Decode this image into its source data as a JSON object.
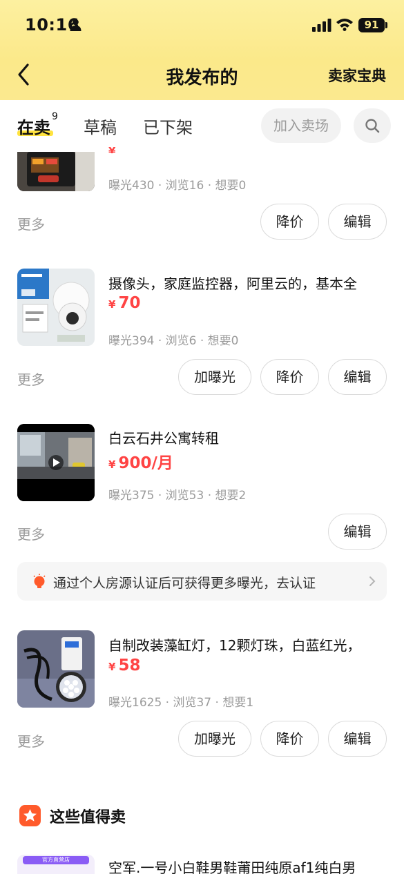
{
  "status_bar": {
    "time": "10:16",
    "battery": "91"
  },
  "nav": {
    "title": "我发布的",
    "seller_guide": "卖家宝典"
  },
  "tabs": {
    "selling": {
      "label": "在卖",
      "count": "9"
    },
    "draft": "草稿",
    "off_shelf": "已下架",
    "join_market": "加入卖场"
  },
  "items": [
    {
      "title": "",
      "price": "",
      "stats": "曝光430 · 浏览16 · 想要0",
      "more": "更多",
      "actions": [
        "降价",
        "编辑"
      ]
    },
    {
      "title": "摄像头，家庭监控器，阿里云的，基本全",
      "price": "70",
      "stats": "曝光394 · 浏览6 · 想要0",
      "more": "更多",
      "actions": [
        "加曝光",
        "降价",
        "编辑"
      ]
    },
    {
      "title": "白云石井公寓转租",
      "price": "900/月",
      "stats": "曝光375 · 浏览53 · 想要2",
      "more": "更多",
      "actions": [
        "编辑"
      ]
    },
    {
      "title": "自制改装藻缸灯，12颗灯珠，白蓝红光，",
      "price": "58",
      "stats": "曝光1625 · 浏览37 · 想要1",
      "more": "更多",
      "actions": [
        "加曝光",
        "降价",
        "编辑"
      ]
    }
  ],
  "price_symbol": "¥",
  "notice": "通过个人房源认证后可获得更多曝光，去认证",
  "recommend": {
    "title": "这些值得卖",
    "items": [
      {
        "title": "空军.一号小白鞋男鞋莆田纯原af1纯白男",
        "badge": "官方直营店"
      }
    ]
  },
  "colors": {
    "accent_yellow": "#fbe98a",
    "price_red": "#ff4444",
    "section_orange": "#ff5a2b"
  }
}
